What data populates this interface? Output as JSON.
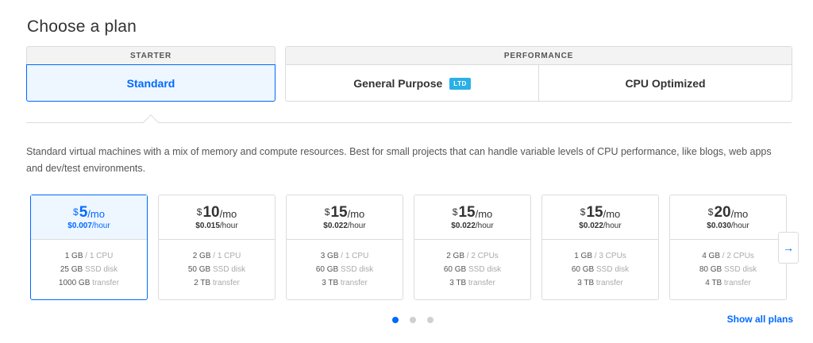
{
  "page_title": "Choose a plan",
  "groups": {
    "starter": {
      "header": "STARTER",
      "tabs": [
        {
          "label": "Standard"
        }
      ]
    },
    "performance": {
      "header": "PERFORMANCE",
      "tabs": [
        {
          "label": "General Purpose",
          "badge": "LTD"
        },
        {
          "label": "CPU Optimized"
        }
      ]
    }
  },
  "description": "Standard virtual machines with a mix of memory and compute resources. Best for small projects that can handle variable levels of CPU performance, like blogs, web apps and dev/test environments.",
  "plans": [
    {
      "currency": "$",
      "price": "5",
      "per": "/mo",
      "hourly": "$0.007",
      "hourly_unit": "/hour",
      "memory": "1 GB",
      "cpu": "/ 1 CPU",
      "disk": "25 GB",
      "disk_label": "SSD disk",
      "transfer": "1000 GB",
      "transfer_label": "transfer"
    },
    {
      "currency": "$",
      "price": "10",
      "per": "/mo",
      "hourly": "$0.015",
      "hourly_unit": "/hour",
      "memory": "2 GB",
      "cpu": "/ 1 CPU",
      "disk": "50 GB",
      "disk_label": "SSD disk",
      "transfer": "2 TB",
      "transfer_label": "transfer"
    },
    {
      "currency": "$",
      "price": "15",
      "per": "/mo",
      "hourly": "$0.022",
      "hourly_unit": "/hour",
      "memory": "3 GB",
      "cpu": "/ 1 CPU",
      "disk": "60 GB",
      "disk_label": "SSD disk",
      "transfer": "3 TB",
      "transfer_label": "transfer"
    },
    {
      "currency": "$",
      "price": "15",
      "per": "/mo",
      "hourly": "$0.022",
      "hourly_unit": "/hour",
      "memory": "2 GB",
      "cpu": "/ 2 CPUs",
      "disk": "60 GB",
      "disk_label": "SSD disk",
      "transfer": "3 TB",
      "transfer_label": "transfer"
    },
    {
      "currency": "$",
      "price": "15",
      "per": "/mo",
      "hourly": "$0.022",
      "hourly_unit": "/hour",
      "memory": "1 GB",
      "cpu": "/ 3 CPUs",
      "disk": "60 GB",
      "disk_label": "SSD disk",
      "transfer": "3 TB",
      "transfer_label": "transfer"
    },
    {
      "currency": "$",
      "price": "20",
      "per": "/mo",
      "hourly": "$0.030",
      "hourly_unit": "/hour",
      "memory": "4 GB",
      "cpu": "/ 2 CPUs",
      "disk": "80 GB",
      "disk_label": "SSD disk",
      "transfer": "4 TB",
      "transfer_label": "transfer"
    }
  ],
  "next_icon": "→",
  "pagination": {
    "pages": 3,
    "current": 1
  },
  "show_all_label": "Show all plans",
  "colors": {
    "accent": "#0069ff",
    "badge": "#2ab0e6",
    "selected_bg": "#eef6ff"
  }
}
